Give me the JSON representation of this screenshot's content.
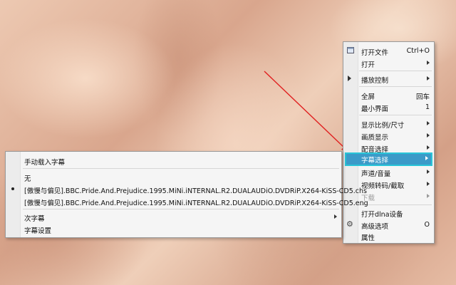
{
  "main_menu": {
    "items": [
      {
        "label": "打开文件",
        "shortcut": "Ctrl+O"
      },
      {
        "label": "打开"
      },
      {
        "label": "播放控制"
      },
      {
        "label": "全屏",
        "shortcut": "回车"
      },
      {
        "label": "最小界面",
        "shortcut": "1"
      },
      {
        "label": "显示比例/尺寸"
      },
      {
        "label": "画质显示"
      },
      {
        "label": "配音选择"
      },
      {
        "label": "字幕选择"
      },
      {
        "label": "声道/音量"
      },
      {
        "label": "视频转码/截取"
      },
      {
        "label": "下载"
      },
      {
        "label": "打开dlna设备"
      },
      {
        "label": "高级选项",
        "shortcut": "O"
      },
      {
        "label": "属性"
      }
    ]
  },
  "subtitle_menu": {
    "items": [
      {
        "label": "手动载入字幕"
      },
      {
        "label": "无"
      },
      {
        "label": "[傲慢与偏见].BBC.Pride.And.Prejudice.1995.MiNi.iNTERNAL.R2.DUALAUDiO.DVDRiP.X264-KiSS-CD5.chs"
      },
      {
        "label": "[傲慢与偏见].BBC.Pride.And.Prejudice.1995.MiNi.iNTERNAL.R2.DUALAUDiO.DVDRiP.X264-KiSS-CD5.eng"
      },
      {
        "label": "次字幕"
      },
      {
        "label": "字幕设置"
      }
    ]
  },
  "colors": {
    "highlight": "#3b9ac8",
    "highlight_border": "#29c5d8",
    "pointer_arrow": "#e02020"
  },
  "icons": [
    "open-file-icon",
    "play-submenu-icon",
    "settings-gear-icon",
    "submenu-arrow-icon",
    "selected-bullet-icon",
    "red-pointer-arrow"
  ]
}
